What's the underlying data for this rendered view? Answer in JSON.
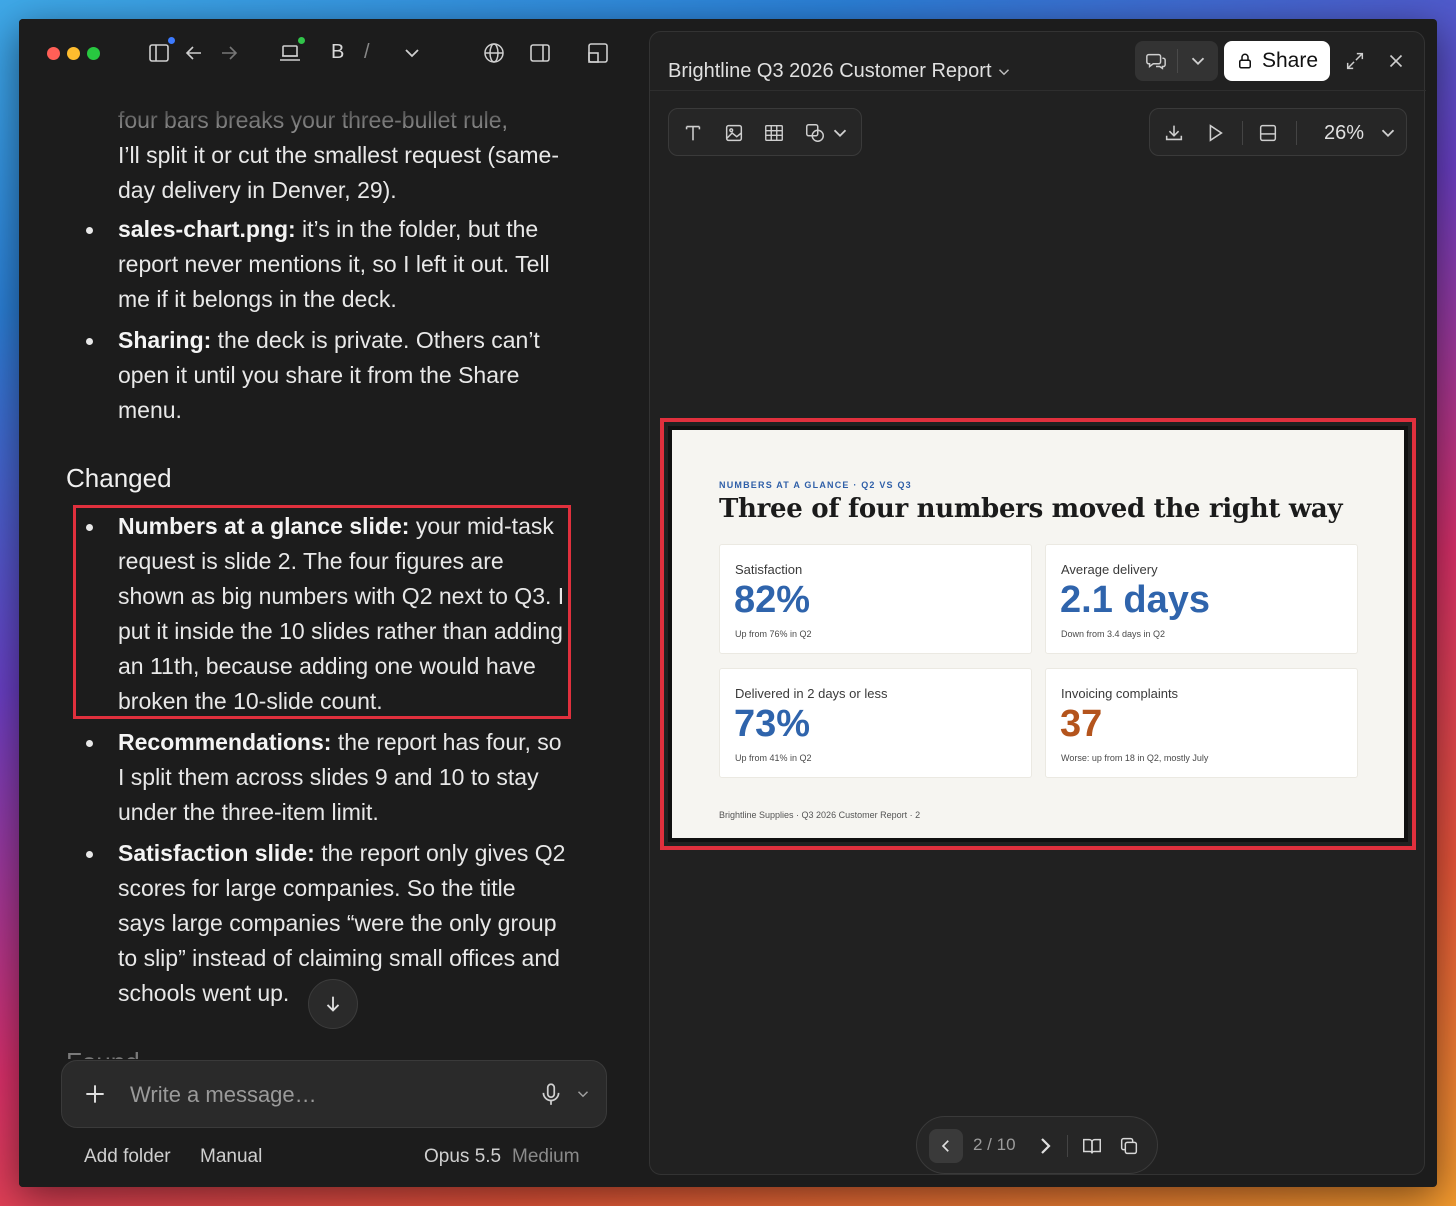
{
  "toolbar": {
    "bold_label": "B",
    "slash_label": "/"
  },
  "chat": {
    "cut_line": "four bars breaks your three-bullet rule,",
    "top_bullet_cont": "I’ll split it or cut the smallest request (same-day delivery in Denver, 29).",
    "bullets_top": [
      {
        "bold": "sales-chart.png:",
        "text": " it’s in the folder, but the report never mentions it, so I left it out. Tell me if it belongs in the deck."
      },
      {
        "bold": "Sharing:",
        "text": " the deck is private. Others can’t open it until you share it from the Share menu."
      }
    ],
    "changed_heading": "Changed",
    "changed_bullets": [
      {
        "bold": "Numbers at a glance slide:",
        "text": " your mid-task request is slide 2. The four figures are shown as big numbers with Q2 next to Q3. I put it inside the 10 slides rather than adding an 11th, because adding one would have broken the 10-slide count."
      },
      {
        "bold": "Recommendations:",
        "text": " the report has four, so I split them across slides 9 and 10 to stay under the three-item limit."
      },
      {
        "bold": "Satisfaction slide:",
        "text": " the report only gives Q2 scores for large companies. So the title says large companies “were the only group to slip” instead of claiming small offices and schools went up."
      }
    ],
    "found_heading": "Found"
  },
  "composer": {
    "placeholder": "Write a message…"
  },
  "footer": {
    "add_folder": "Add folder",
    "manual": "Manual",
    "model": "Opus 5.5",
    "effort": "Medium"
  },
  "viewer": {
    "title": "Brightline Q3 2026 Customer Report",
    "share_label": "Share",
    "zoom": "26%",
    "page_indicator": "2 / 10"
  },
  "slide": {
    "kicker": "NUMBERS AT A GLANCE · Q2 VS Q3",
    "title": "Three of four numbers moved the right way",
    "cards": [
      {
        "label": "Satisfaction",
        "value": "82%",
        "note": "Up from 76% in Q2"
      },
      {
        "label": "Average delivery",
        "value": "2.1 days",
        "note": "Down from 3.4 days in Q2"
      },
      {
        "label": "Delivered in 2 days or less",
        "value": "73%",
        "note": "Up from 41% in Q2"
      },
      {
        "label": "Invoicing complaints",
        "value": "37",
        "note": "Worse: up from 18 in Q2, mostly July"
      }
    ],
    "footer": "Brightline Supplies · Q3 2026 Customer Report · 2"
  },
  "colors": {
    "accent_blue": "#2f64ac",
    "warn_orange": "#b4541c",
    "highlight_red": "#e0303d"
  },
  "icons": [
    "sidebar-icon",
    "back-arrow-icon",
    "forward-arrow-icon",
    "laptop-icon",
    "chevron-down-icon",
    "globe-icon",
    "split-view-icon",
    "layout-icon",
    "comments-icon",
    "lock-icon",
    "expand-icon",
    "close-icon",
    "text-tool-icon",
    "image-tool-icon",
    "table-tool-icon",
    "shapes-tool-icon",
    "download-icon",
    "play-icon",
    "slide-layout-icon",
    "plus-icon",
    "microphone-icon",
    "arrow-down-icon",
    "book-icon",
    "duplicate-icon"
  ]
}
